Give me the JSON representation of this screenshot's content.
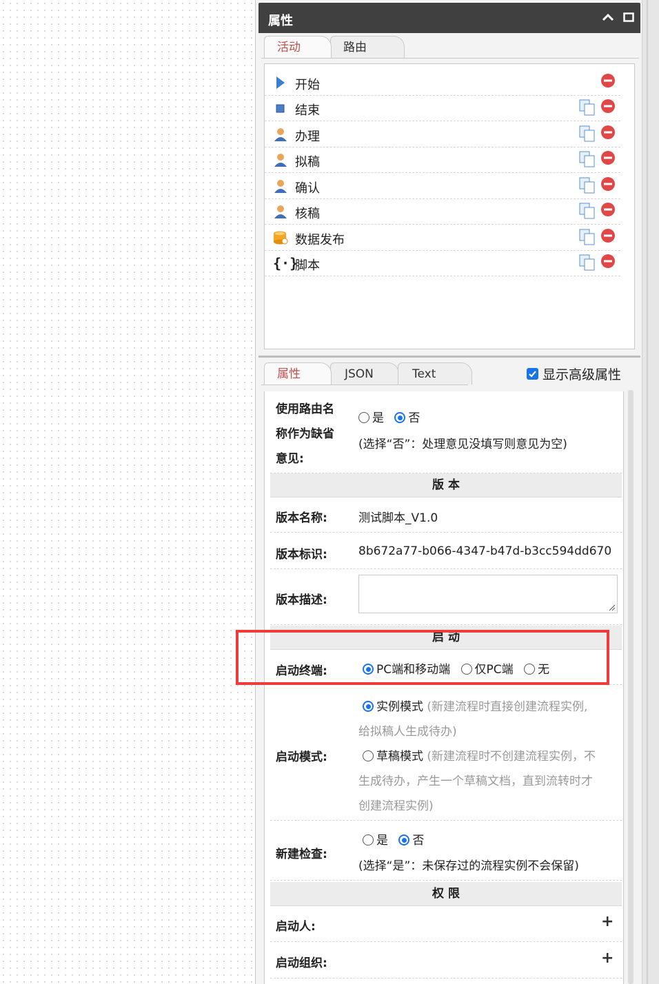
{
  "panel": {
    "title": "属性"
  },
  "top_tabs": [
    {
      "label": "活动"
    },
    {
      "label": "路由"
    }
  ],
  "activities": [
    {
      "label": "开始",
      "icon": "play-triangle-icon",
      "copy": false
    },
    {
      "label": "结束",
      "icon": "stop-square-icon",
      "copy": true
    },
    {
      "label": "办理",
      "icon": "user-icon",
      "copy": true
    },
    {
      "label": "拟稿",
      "icon": "user-icon",
      "copy": true
    },
    {
      "label": "确认",
      "icon": "user-icon",
      "copy": true
    },
    {
      "label": "核稿",
      "icon": "user-icon",
      "copy": true
    },
    {
      "label": "数据发布",
      "icon": "database-icon",
      "copy": true
    },
    {
      "label": "脚本",
      "icon": "curly-braces-icon",
      "copy": true
    }
  ],
  "bottom_tabs": [
    {
      "label": "属性"
    },
    {
      "label": "JSON"
    },
    {
      "label": "Text"
    }
  ],
  "advanced": {
    "label": "显示高级属性",
    "checked": true
  },
  "form": {
    "route_default": {
      "label_lines": [
        "使用路由名",
        "称作为缺省",
        "意见:"
      ],
      "yes": "是",
      "no": "否",
      "hint": "(选择“否”：处理意见没填写则意见为空)"
    },
    "version_section": "版 本",
    "version_name": {
      "label": "版本名称:",
      "value": "测试脚本_V1.0"
    },
    "version_id": {
      "label": "版本标识:",
      "value": "8b672a77-b066-4347-b47d-b3cc594dd670"
    },
    "version_desc": {
      "label": "版本描述:"
    },
    "start_section": "启 动",
    "start_terminal": {
      "label": "启动终端:",
      "opt1": "PC端和移动端",
      "opt2": "仅PC端",
      "opt3": "无"
    },
    "start_mode": {
      "label": "启动模式:",
      "instance": "实例模式",
      "instance_hint_1": "(新建流程时直接创建流程实例,",
      "instance_hint_2": "给拟稿人生成待办)",
      "draft": "草稿模式",
      "draft_hint_1": "(新建流程时不创建流程实例，不",
      "draft_hint_2": "生成待办，产生一个草稿文档，直到流转时才",
      "draft_hint_3": "创建流程实例)"
    },
    "new_check": {
      "label": "新建检查:",
      "yes": "是",
      "no": "否",
      "hint": "(选择“是”：未保存过的流程实例不会保留)"
    },
    "permission_section": "权 限",
    "starter": {
      "label": "启动人:"
    },
    "start_org": {
      "label": "启动组织:"
    }
  },
  "colors": {
    "accent": "#1a73e8",
    "active_tab": "#c0504d",
    "header": "#404040",
    "highlight": "#ee3b3b"
  }
}
